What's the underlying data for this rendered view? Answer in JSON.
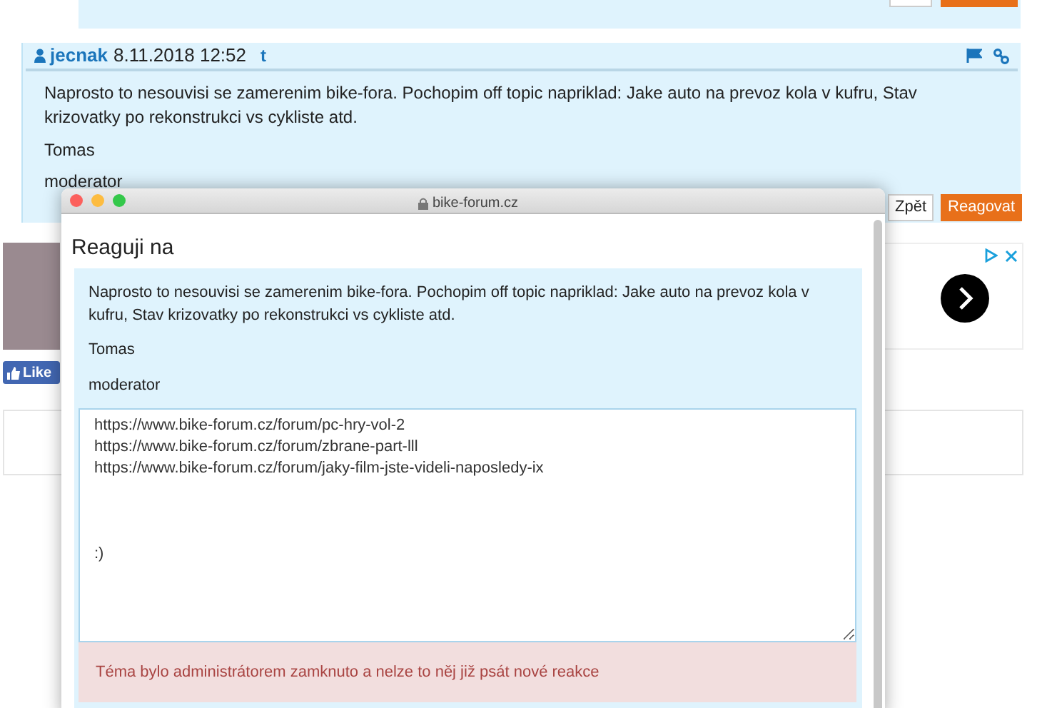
{
  "post": {
    "author": "jecnak",
    "date": "8.11.2018 12:52",
    "reply_marker": "t",
    "body": "Naprosto to nesouvisi se zamerenim bike-fora. Pochopim off topic napriklad: Jake auto na prevoz kola v kufru, Stav krizovatky po rekonstrukci vs cykliste atd.",
    "signature": [
      "Tomas",
      "moderator"
    ],
    "buttons": [
      "Zpět",
      "Reagovat"
    ]
  },
  "sidebar": {
    "like_label": "Like"
  },
  "modal": {
    "window": {
      "title": "bike-forum.cz"
    },
    "heading": "Reaguji na",
    "quote": {
      "body": "Naprosto to nesouvisi se zamerenim bike-fora. Pochopim off topic napriklad: Jake auto na prevoz kola v kufru, Stav krizovatky po rekonstrukci vs cykliste atd.",
      "signature": [
        "Tomas",
        "moderator"
      ]
    },
    "reply": {
      "value": "https://www.bike-forum.cz/forum/pc-hry-vol-2\nhttps://www.bike-forum.cz/forum/zbrane-part-lll\nhttps://www.bike-forum.cz/forum/jaky-film-jste-videli-naposledy-ix\n\n\n\n:)"
    },
    "alert": {
      "kind": "error",
      "text": "Téma bylo administrátorem zamknuto a nelze to něj již psát nové reakce"
    }
  }
}
